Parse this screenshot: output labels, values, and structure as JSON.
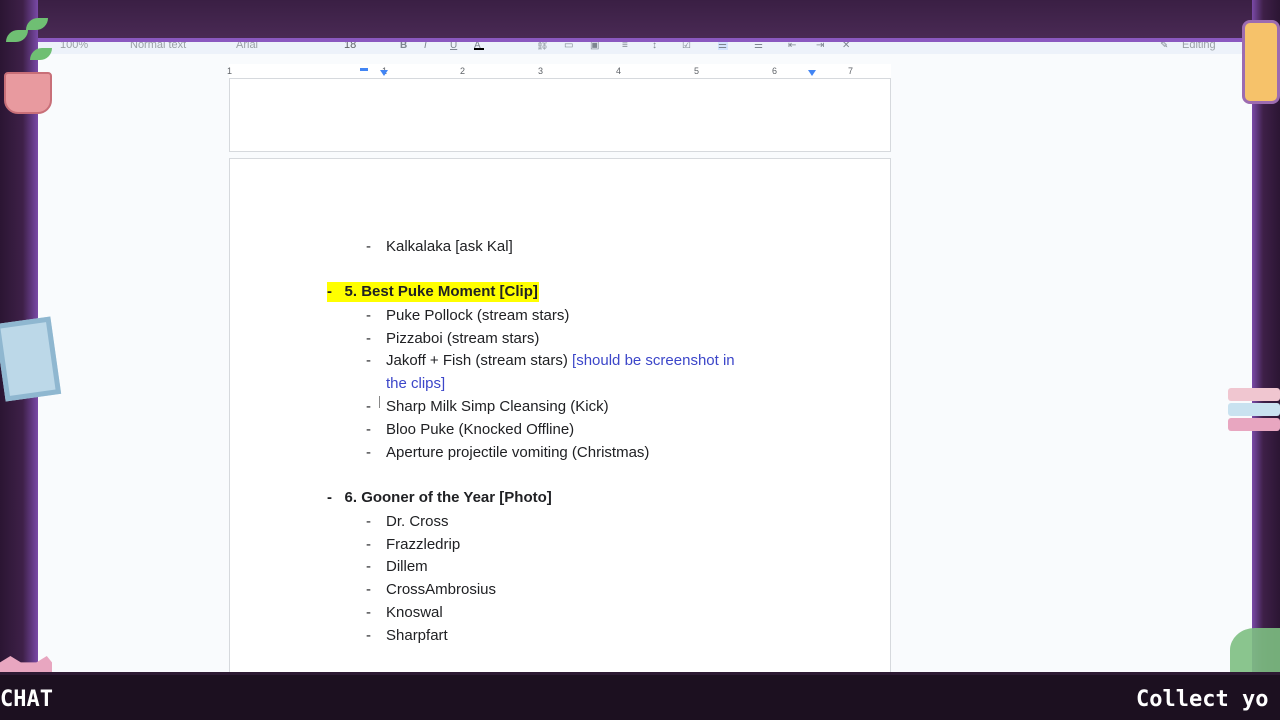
{
  "toolbar": {
    "zoom": "100%",
    "style": "Normal text",
    "font": "Arial",
    "font_size": "18",
    "mode": "Editing"
  },
  "ruler": {
    "numbers": [
      "1",
      "1",
      "2",
      "3",
      "4",
      "5",
      "6",
      "7"
    ]
  },
  "document": {
    "prev_item": "Kalkalaka [ask Kal]",
    "sections": [
      {
        "heading": "5. Best Puke Moment [Clip]",
        "highlighted": true,
        "items": [
          {
            "text": "Puke Pollock (stream stars)"
          },
          {
            "text": "Pizzaboi (stream stars)"
          },
          {
            "text": "Jakoff + Fish (stream stars)",
            "note": "[should be screenshot in",
            "note_cont": "the clips]"
          },
          {
            "text": "Sharp Milk Simp Cleansing (Kick)"
          },
          {
            "text": "Bloo Puke (Knocked Offline)"
          },
          {
            "text": "Aperture projectile vomiting (Christmas)"
          }
        ]
      },
      {
        "heading": "6. Gooner of the Year [Photo]",
        "highlighted": false,
        "items": [
          {
            "text": "Dr. Cross"
          },
          {
            "text": "Frazzledrip"
          },
          {
            "text": "Dillem"
          },
          {
            "text": "CrossAmbrosius"
          },
          {
            "text": "Knoswal"
          },
          {
            "text": "Sharpfart"
          }
        ]
      }
    ],
    "dash": "-"
  },
  "overlay": {
    "ticker_left": "CHAT",
    "ticker_right": "Collect yo"
  },
  "colors": {
    "highlight": "#ffff00",
    "note": "#3c46c9",
    "frame_accent": "#8a58c0"
  }
}
